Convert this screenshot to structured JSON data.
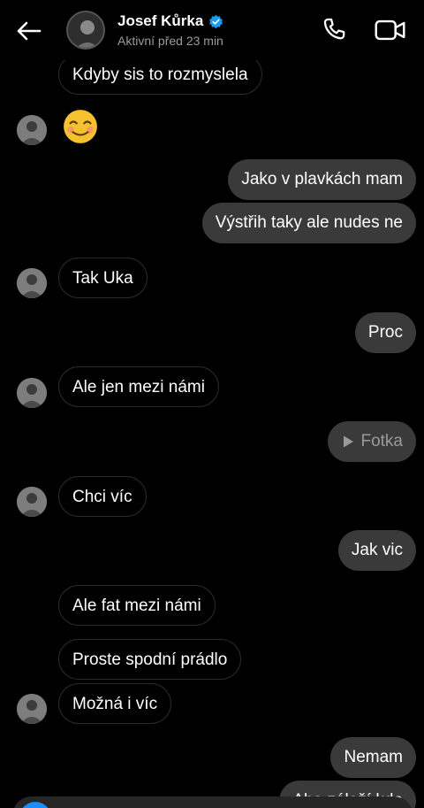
{
  "header": {
    "name": "Josef Kůrka",
    "status": "Aktivní před 23 min"
  },
  "messages": {
    "m0": "Kdyby sis to rozmyslela",
    "m1": "Jako v plavkách mam",
    "m2": "Výstřih taky ale nudes ne",
    "m3": "Tak Uka",
    "m4": "Proc",
    "m5": "Ale jen mezi námi",
    "m6": "Fotka",
    "m7": "Chci víc",
    "m8": "Jak vic",
    "m9": "Ale fat mezi námi",
    "m10": "Proste spodní prádlo",
    "m11": "Možná i víc",
    "m12": "Nemam",
    "m13": "Aha záleží kde"
  },
  "colors": {
    "background": "#000000",
    "outgoing_bubble": "#3a3a3a",
    "verified": "#1d9bf0",
    "camera_button": "#1a8cff"
  }
}
